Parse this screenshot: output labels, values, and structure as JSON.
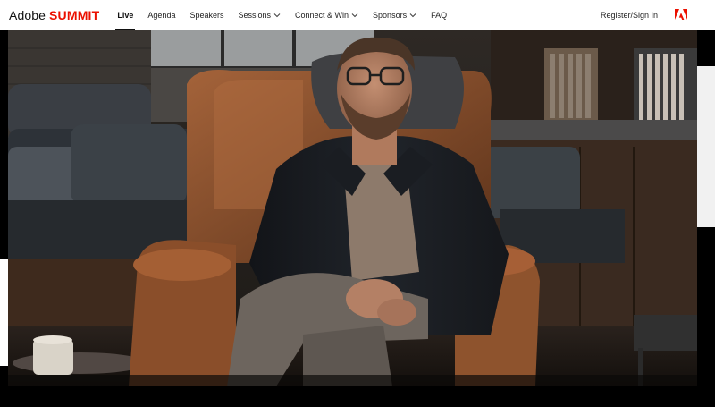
{
  "brand": {
    "name_primary": "Adobe",
    "name_secondary": "SUMMIT"
  },
  "nav": {
    "items": [
      {
        "label": "Live",
        "active": true,
        "has_dropdown": false
      },
      {
        "label": "Agenda",
        "active": false,
        "has_dropdown": false
      },
      {
        "label": "Speakers",
        "active": false,
        "has_dropdown": false
      },
      {
        "label": "Sessions",
        "active": false,
        "has_dropdown": true
      },
      {
        "label": "Connect & Win",
        "active": false,
        "has_dropdown": true
      },
      {
        "label": "Sponsors",
        "active": false,
        "has_dropdown": true
      },
      {
        "label": "FAQ",
        "active": false,
        "has_dropdown": false
      }
    ],
    "signin_label": "Register/Sign In"
  },
  "colors": {
    "brand_red": "#eb1000",
    "text_dark": "#111111"
  },
  "icons": {
    "chevron": "chevron-down-icon",
    "logo": "adobe-logo-icon"
  }
}
